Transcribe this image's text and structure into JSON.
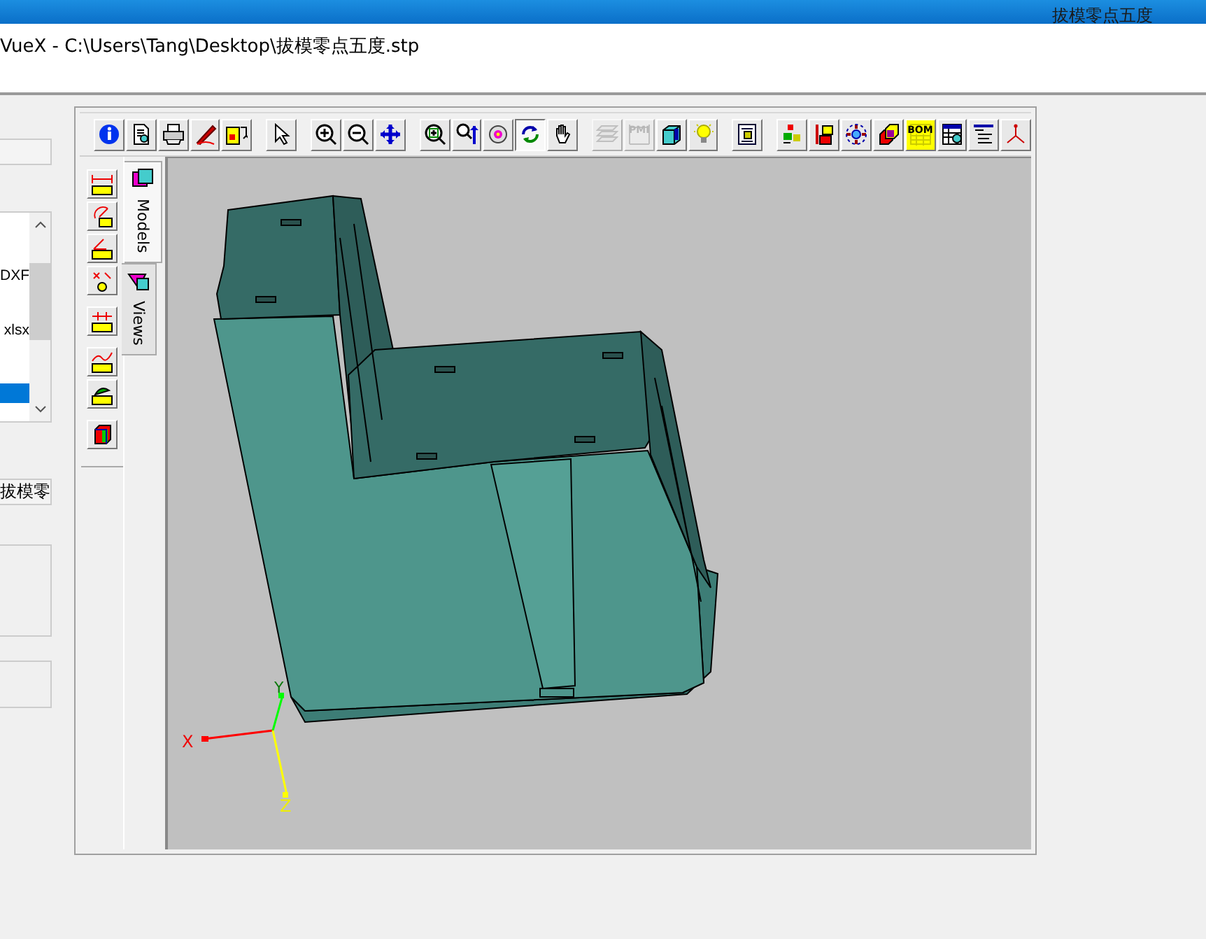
{
  "window": {
    "title": "拔模零点五度"
  },
  "header": {
    "path": "VueX - C:\\Users\\Tang\\Desktop\\拔模零点五度.stp"
  },
  "side_panel": {
    "list": [
      {
        "text": "DXF",
        "selected": false
      },
      {
        "text": "xlsx",
        "selected": false
      },
      {
        "selected": true
      }
    ],
    "name_field": "拔模零"
  },
  "toolbar": [
    {
      "gap_before": false,
      "selected": false,
      "disabled": false
    },
    {
      "gap_before": false,
      "selected": false,
      "disabled": false
    },
    {
      "gap_before": false,
      "selected": false,
      "disabled": false
    },
    {
      "gap_before": false,
      "selected": false,
      "disabled": false
    },
    {
      "gap_before": false,
      "selected": false,
      "disabled": false
    },
    {
      "gap_before": true,
      "selected": false,
      "disabled": false
    },
    {
      "gap_before": true,
      "selected": false,
      "disabled": false
    },
    {
      "gap_before": false,
      "selected": false,
      "disabled": false
    },
    {
      "gap_before": false,
      "selected": false,
      "disabled": false
    },
    {
      "gap_before": true,
      "selected": false,
      "disabled": false
    },
    {
      "gap_before": false,
      "selected": false,
      "disabled": false
    },
    {
      "gap_before": false,
      "selected": false,
      "disabled": false
    },
    {
      "gap_before": false,
      "selected": true,
      "disabled": false
    },
    {
      "gap_before": false,
      "selected": false,
      "disabled": false
    },
    {
      "gap_before": true,
      "selected": false,
      "disabled": true
    },
    {
      "gap_before": false,
      "selected": false,
      "disabled": true,
      "label": "PMI"
    },
    {
      "gap_before": false,
      "selected": false,
      "disabled": false
    },
    {
      "gap_before": false,
      "selected": false,
      "disabled": false
    },
    {
      "gap_before": true,
      "selected": false,
      "disabled": false
    },
    {
      "gap_before": true,
      "selected": false,
      "disabled": false
    },
    {
      "gap_before": false,
      "selected": false,
      "disabled": false
    },
    {
      "gap_before": false,
      "selected": false,
      "disabled": false
    },
    {
      "gap_before": false,
      "selected": false,
      "disabled": false
    },
    {
      "gap_before": false,
      "selected": false,
      "disabled": false,
      "label": "BOM"
    },
    {
      "gap_before": false,
      "selected": false,
      "disabled": false
    },
    {
      "gap_before": false,
      "selected": false,
      "disabled": false
    },
    {
      "gap_before": false,
      "selected": false,
      "disabled": false
    }
  ],
  "tabs": [
    {
      "label": "Models",
      "selected": true
    },
    {
      "label": "Views",
      "selected": false
    }
  ],
  "axes": [
    "X",
    "Y",
    "Z"
  ]
}
